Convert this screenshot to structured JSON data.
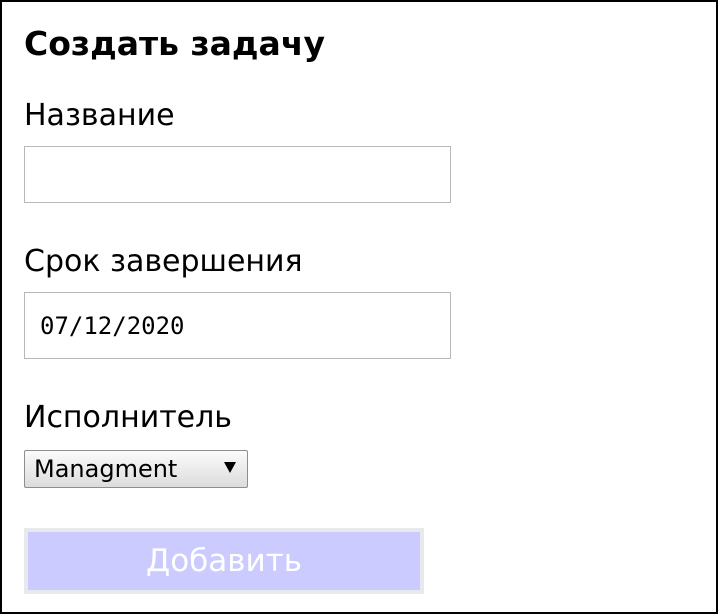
{
  "form": {
    "title": "Создать задачу",
    "name_label": "Название",
    "name_value": "",
    "due_label": "Срок завершения",
    "due_value": "07/12/2020",
    "assignee_label": "Исполнитель",
    "assignee_selected": "Managment",
    "assignee_arrow_icon": "triangle-down-icon",
    "submit_label": "Добавить"
  },
  "colors": {
    "button_background": "#cbcbff",
    "button_text": "#ffffff",
    "frame_border": "#000000",
    "input_border": "#b8b8b8"
  }
}
